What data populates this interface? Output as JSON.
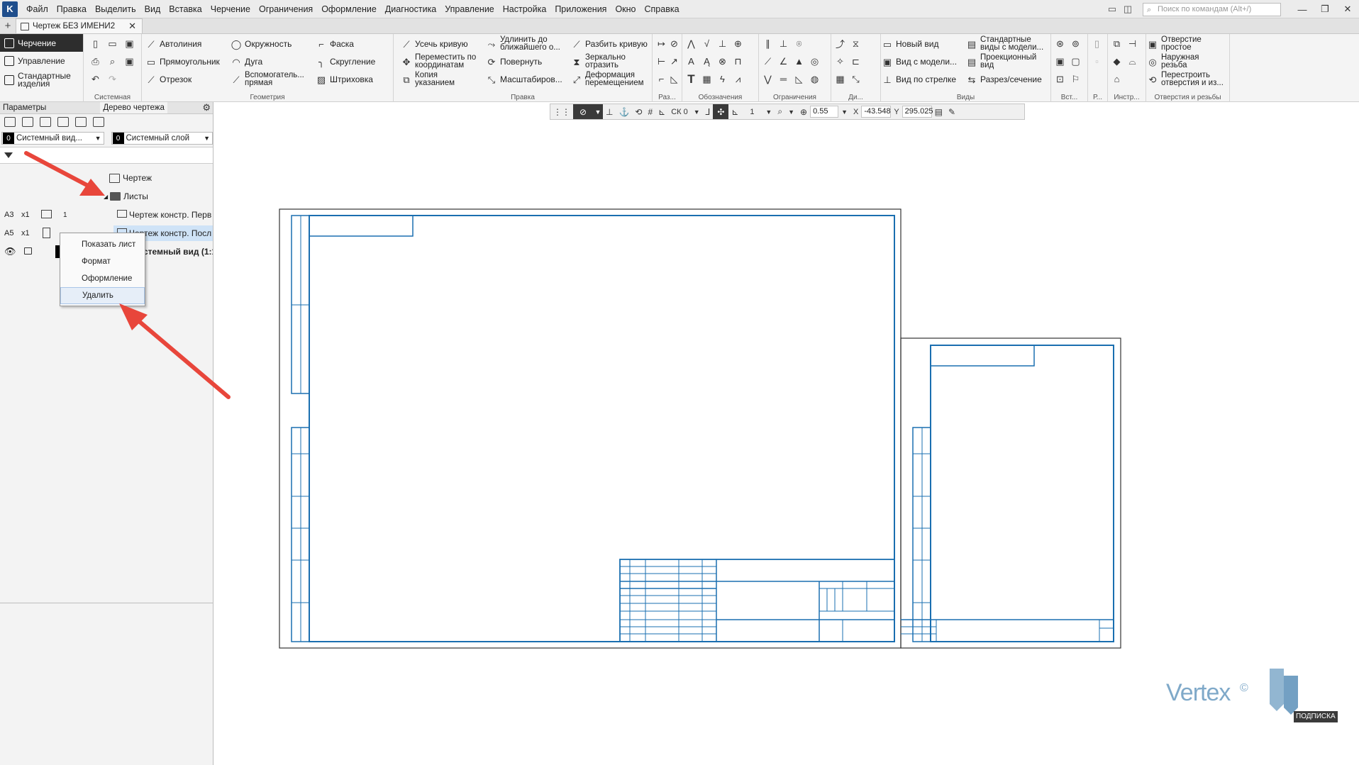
{
  "menubar": {
    "items": [
      "Файл",
      "Правка",
      "Выделить",
      "Вид",
      "Вставка",
      "Черчение",
      "Ограничения",
      "Оформление",
      "Диагностика",
      "Управление",
      "Настройка",
      "Приложения",
      "Окно",
      "Справка"
    ],
    "search_placeholder": "Поиск по командам (Alt+/)"
  },
  "tabbar": {
    "doc_tab": "Чертеж БЕЗ ИМЕНИ2"
  },
  "ribbon": {
    "modes": [
      "Черчение",
      "Управление",
      "Стандартные изделия"
    ],
    "panel_labels": [
      "Системная",
      "Геометрия",
      "Правка",
      "Раз...",
      "Обозначения",
      "Ограничения",
      "Ди...",
      "Виды",
      "Вст...",
      "Р...",
      "Инстр...",
      "Отверстия и резьбы"
    ],
    "geometry": [
      "Автолиния",
      "Окружность",
      "Фаска",
      "Прямоугольник",
      "Дуга",
      "Скругление",
      "Отрезок",
      "Вспомогатель... прямая",
      "Штриховка"
    ],
    "edit": [
      "Усечь кривую",
      "Удлинить до ближайшего о...",
      "Разбить кривую",
      "Переместить по координатам",
      "Повернуть",
      "Зеркально отразить",
      "Копия указанием",
      "Масштабиров...",
      "Деформация перемещением"
    ],
    "views": [
      "Новый вид",
      "Стандартные виды с модели...",
      "Вид с модели...",
      "Проекционный вид",
      "Вид по стрелке",
      "Разрез/сечение"
    ],
    "holes": [
      "Отверстие простое",
      "Наружная резьба",
      "Перестроить отверстия и из..."
    ]
  },
  "leftpanel": {
    "tabs": [
      "Параметры",
      "Дерево чертежа"
    ],
    "view_combo": {
      "num": "0",
      "text": "Системный вид..."
    },
    "layer_combo": {
      "num": "0",
      "text": "Системный слой"
    },
    "tree": {
      "root": "Чертеж",
      "sheets_folder": "Листы",
      "sheet1": {
        "format": "A3",
        "mult": "x1",
        "num": "1",
        "name": "Чертеж констр. Перв"
      },
      "sheet2": {
        "format": "A5",
        "mult": "x1",
        "name": "Чертеж констр. Посл"
      },
      "view_row": "стемный вид (1:1"
    }
  },
  "context_menu": {
    "items": [
      "Показать лист",
      "Формат",
      "Оформление",
      "Удалить"
    ]
  },
  "snapbar": {
    "cs": "СК 0",
    "step": "1",
    "zoom": "0.55",
    "x_label": "X",
    "x_value": "-43.548",
    "y_label": "Y",
    "y_value": "295.025"
  },
  "watermark": {
    "brand": "Vertex",
    "reg": "©",
    "badge": "ПОДПИСКА"
  },
  "colors": {
    "frame_blue": "#1a6fb0",
    "arrow_red": "#e8463b",
    "active_mode": "#2d2d2d"
  }
}
